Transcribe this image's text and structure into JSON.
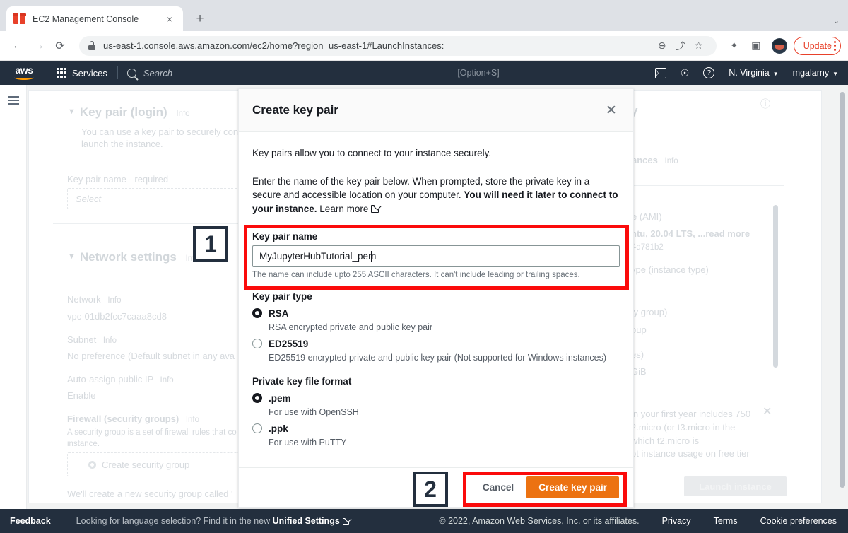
{
  "browser": {
    "tab": {
      "title": "EC2 Management Console",
      "favicon_name": "gift-box-favicon",
      "close_label": "×"
    },
    "new_tab_label": "+",
    "tabstrip_menu_label": "⌄",
    "toolbar": {
      "back_label": "←",
      "forward_label": "→",
      "reload_label": "⟳",
      "url": "us-east-1.console.aws.amazon.com/ec2/home?region=us-east-1#LaunchInstances:",
      "zoom_out_label": "⊖",
      "share_label": "⤴",
      "bookmark_label": "☆",
      "extensions_label": "✦",
      "sidepanel_label": "▣",
      "update_label": "Update",
      "menu_label": "⋮"
    }
  },
  "aws_nav": {
    "logo_word": "aws",
    "services_label": "Services",
    "search_placeholder": "Search",
    "search_shortcut": "[Option+S]",
    "cloudshell_label": "〉_",
    "bell_label": "⭔",
    "help_label": "?",
    "region": "N. Virginia",
    "account": "mgalarny",
    "caret": "▼"
  },
  "background": {
    "left": {
      "section_key_pair": "Key pair (login)",
      "info_label": "Info",
      "key_pair_desc_1": "You can use a key pair to securely connect t",
      "key_pair_desc_2": "launch the instance.",
      "key_pair_name_label": "Key pair name - required",
      "key_pair_select_placeholder": "Select",
      "section_network": "Network settings",
      "network_label": "Network",
      "network_value": "vpc-01db2fcc7caaa8cd8",
      "subnet_label": "Subnet",
      "subnet_value": "No preference (Default subnet in any ava",
      "auto_ip_label": "Auto-assign public IP",
      "auto_ip_value": "Enable",
      "firewall_label": "Firewall (security groups)",
      "firewall_desc_1": "A security group is a set of firewall rules that co",
      "firewall_desc_2": "instance.",
      "create_sg_label": "Create security group",
      "sg_note": "We'll create a new security group called '"
    },
    "right": {
      "summary_partial": "y",
      "instances_label": "ances",
      "info_label": "Info",
      "ami_partial": "e (AMI)",
      "ami_value": "ntu, 20.04 LTS, ...read more",
      "ami_id": "4d781b2",
      "instance_type_partial": "ype (instance type)",
      "security_group_partial": "ty group)",
      "group_partial": "oup",
      "storage_partial": "es)",
      "storage_value": "GiB",
      "free_tier_1": "in your first year includes 750",
      "free_tier_2": "2.micro (or t3.micro in the",
      "free_tier_3": "which t2.micro is",
      "free_tier_4": "ot instance usage on free tier",
      "launch_button": "Launch instance",
      "close_label": "✕",
      "info_circle_label": "ⓘ"
    }
  },
  "modal": {
    "title": "Create key pair",
    "close_label": "✕",
    "intro": "Key pairs allow you to connect to your instance securely.",
    "body_part_1": "Enter the name of the key pair below. When prompted, store the private key in a secure and accessible location on your computer. ",
    "body_bold": "You will need it later to connect to your instance.",
    "learn_more": "Learn more",
    "key_pair_name": {
      "label": "Key pair name",
      "value": "MyJupyterHubTutorial_pem",
      "hint": "The name can include upto 255 ASCII characters. It can't include leading or trailing spaces."
    },
    "key_pair_type": {
      "title": "Key pair type",
      "options": [
        {
          "label": "RSA",
          "desc": "RSA encrypted private and public key pair",
          "selected": true
        },
        {
          "label": "ED25519",
          "desc": "ED25519 encrypted private and public key pair (Not supported for Windows instances)",
          "selected": false
        }
      ]
    },
    "private_key_format": {
      "title": "Private key file format",
      "options": [
        {
          "label": ".pem",
          "desc": "For use with OpenSSH",
          "selected": true
        },
        {
          "label": ".ppk",
          "desc": "For use with PuTTY",
          "selected": false
        }
      ]
    },
    "footer": {
      "cancel_label": "Cancel",
      "submit_label": "Create key pair"
    }
  },
  "annotations": {
    "marker_1": "1",
    "marker_2": "2",
    "highlight_color": "#fb0b0b"
  },
  "footer": {
    "feedback": "Feedback",
    "language_text": "Looking for language selection? Find it in the new ",
    "language_bold": "Unified Settings",
    "copyright": "© 2022, Amazon Web Services, Inc. or its affiliates.",
    "privacy": "Privacy",
    "terms": "Terms",
    "cookie": "Cookie preferences"
  }
}
